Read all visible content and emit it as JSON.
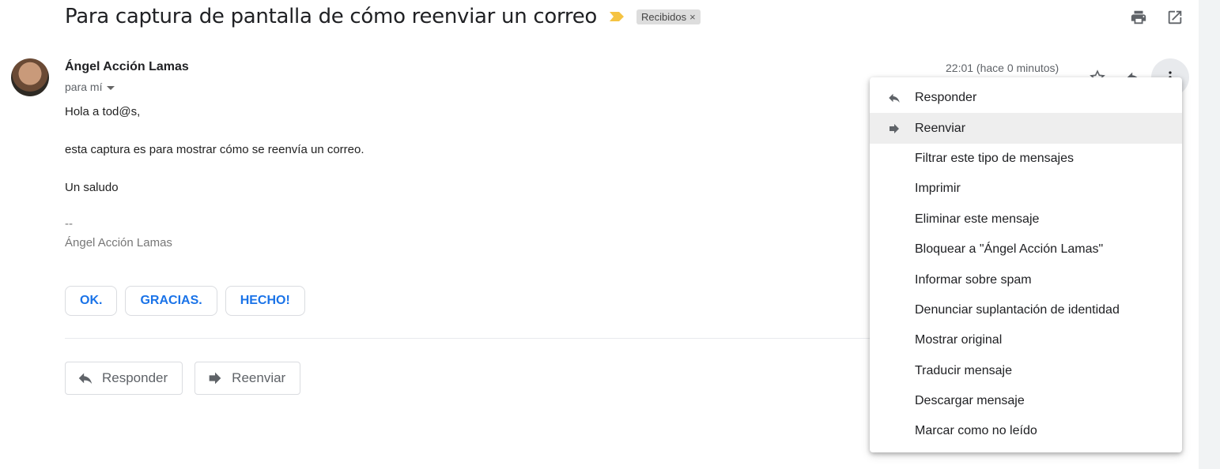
{
  "subject": {
    "title": "Para captura de pantalla de cómo reenviar un correo",
    "label": "Recibidos",
    "label_close": "×"
  },
  "top_icons": [
    "print-icon",
    "open-in-new-window-icon"
  ],
  "message": {
    "sender": "Ángel Acción Lamas",
    "recipient": "para mí",
    "timestamp": "22:01 (hace 0 minutos)",
    "body": {
      "greeting": "Hola a tod@s,",
      "line1": "esta captura es para mostrar cómo se reenvía un correo.",
      "closing": "Un saludo",
      "sig_sep": "--",
      "signature": "Ángel Acción Lamas"
    }
  },
  "smart_replies": [
    "OK.",
    "GRACIAS.",
    "HECHO!"
  ],
  "actions": {
    "reply": "Responder",
    "forward": "Reenviar"
  },
  "menu": {
    "items": [
      "Responder",
      "Reenviar",
      "Filtrar este tipo de mensajes",
      "Imprimir",
      "Eliminar este mensaje",
      "Bloquear a \"Ángel Acción Lamas\"",
      "Informar sobre spam",
      "Denunciar suplantación de identidad",
      "Mostrar original",
      "Traducir mensaje",
      "Descargar mensaje",
      "Marcar como no leído"
    ],
    "highlighted": "Reenviar"
  },
  "colors": {
    "accent": "#1a73e8",
    "importance": "#f5c342",
    "menu_highlight": "#eeeeee"
  }
}
